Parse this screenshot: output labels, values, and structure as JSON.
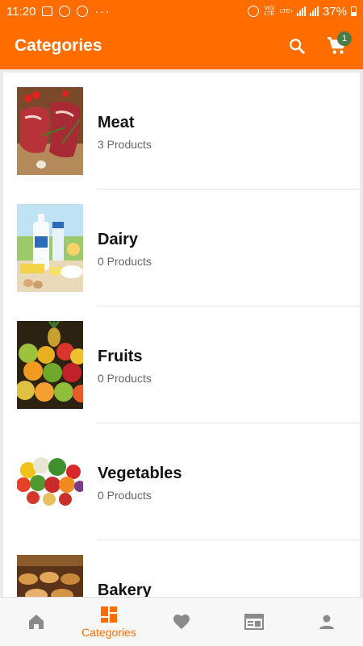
{
  "status_bar": {
    "time": "11:20",
    "battery": "37%",
    "network_volte": "Vo)) LTE",
    "network_lte": "LTE+"
  },
  "app_bar": {
    "title": "Categories",
    "cart_count": "1",
    "icons": [
      "search-icon",
      "cart-icon"
    ]
  },
  "categories": [
    {
      "name": "Meat",
      "count": "3 Products"
    },
    {
      "name": "Dairy",
      "count": "0 Products"
    },
    {
      "name": "Fruits",
      "count": "0 Products"
    },
    {
      "name": "Vegetables",
      "count": "0 Products"
    },
    {
      "name": "Bakery",
      "count": ""
    }
  ],
  "bottom_nav": {
    "items": [
      {
        "icon": "home-icon",
        "label": ""
      },
      {
        "icon": "categories-icon",
        "label": "Categories"
      },
      {
        "icon": "heart-icon",
        "label": ""
      },
      {
        "icon": "news-icon",
        "label": ""
      },
      {
        "icon": "person-icon",
        "label": ""
      }
    ],
    "active_index": 1
  },
  "colors": {
    "accent": "#ff6d00",
    "badge": "#4f7a4a",
    "nav_inactive": "#8a8a8a"
  }
}
